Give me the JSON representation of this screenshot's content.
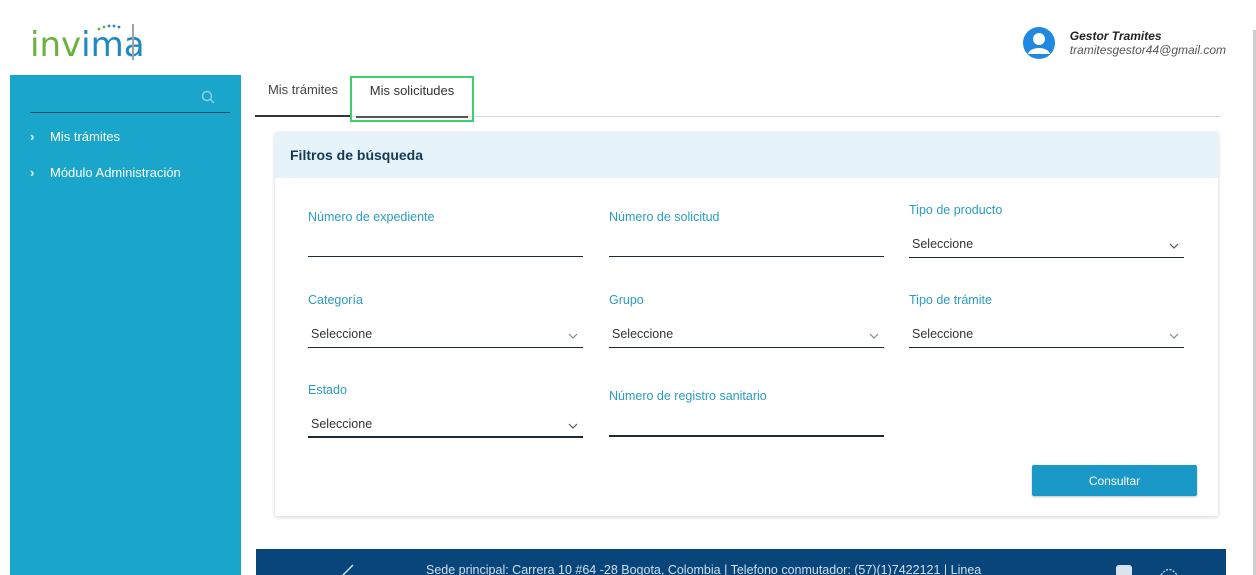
{
  "header": {
    "logo_alt": "invima",
    "user_name": "Gestor Tramites",
    "user_email": "tramitesgestor44@gmail.com"
  },
  "sidebar": {
    "search_placeholder": "",
    "items": [
      {
        "label": "Mis trámites",
        "icon": "chevron-right-icon"
      },
      {
        "label": "Módulo Administración",
        "icon": "chevron-right-icon"
      }
    ]
  },
  "tabs": [
    {
      "label": "Mis trámites",
      "active": true
    },
    {
      "label": "Mis solicitudes",
      "active": false,
      "highlighted": true
    }
  ],
  "filters": {
    "title": "Filtros de búsqueda",
    "fields": {
      "numero_expediente": {
        "label": "Número de expediente",
        "value": ""
      },
      "numero_solicitud": {
        "label": "Número de solicitud",
        "value": ""
      },
      "tipo_producto": {
        "label": "Tipo de producto",
        "value": "Seleccione"
      },
      "categoria": {
        "label": "Categoría",
        "value": "Seleccione"
      },
      "grupo": {
        "label": "Grupo",
        "value": "Seleccione"
      },
      "tipo_tramite": {
        "label": "Tipo de trámite",
        "value": "Seleccione"
      },
      "estado": {
        "label": "Estado",
        "value": "Seleccione"
      },
      "registro_sanitario": {
        "label": "Número de registro sanitario",
        "value": ""
      }
    },
    "submit_label": "Consultar"
  },
  "footer": {
    "text": "Sede principal: Carrera 10 #64 -28 Bogota, Colombia | Telefono conmutador: (57)(1)7422121 | Linea"
  },
  "colors": {
    "sidebar": "#1aa5cb",
    "accent_label": "#2a9cc4",
    "button": "#1a98c7",
    "card_header": "#e6f3f8",
    "footer": "#08457a",
    "tab_highlight": "#3ccf6e"
  }
}
